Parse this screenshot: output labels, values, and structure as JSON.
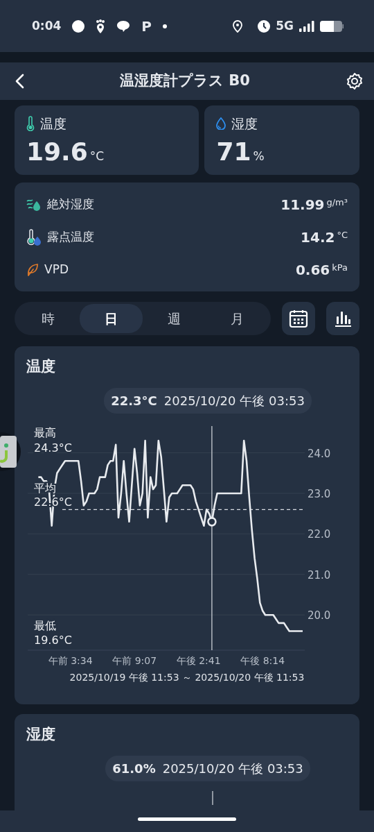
{
  "status_bar": {
    "time": "0:04",
    "notification_glyph": "P",
    "network": "5G"
  },
  "header": {
    "title": "温湿度計プラス B0"
  },
  "readings": [
    {
      "label": "温度",
      "value": "19.6",
      "unit": "°C"
    },
    {
      "label": "湿度",
      "value": "71",
      "unit": "%"
    }
  ],
  "details": [
    {
      "label": "絶対湿度",
      "value": "11.99",
      "unit": "g/m³"
    },
    {
      "label": "露点温度",
      "value": "14.2",
      "unit": "°C"
    },
    {
      "label": "VPD",
      "value": "0.66",
      "unit": "kPa"
    }
  ],
  "period_tabs": [
    {
      "label": "時",
      "selected": false
    },
    {
      "label": "日",
      "selected": true
    },
    {
      "label": "週",
      "selected": false
    },
    {
      "label": "月",
      "selected": false
    }
  ],
  "charts": [
    {
      "title": "温度",
      "tooltip": {
        "value": "22.3°C",
        "time": "2025/10/20 午後 03:53"
      },
      "stats": [
        {
          "label": "最高",
          "value": "24.3°C"
        },
        {
          "label": "平均",
          "value": "22.6°C"
        },
        {
          "label": "最低",
          "value": "19.6°C"
        }
      ],
      "range": "2025/10/19 午後 11:53 ～ 2025/10/20 午後 11:53",
      "chart_data": {
        "type": "line",
        "ylim": [
          19.13,
          24.66
        ],
        "yticks": [
          {
            "value": 20,
            "label": "20.0"
          },
          {
            "value": 21,
            "label": "21.0"
          },
          {
            "value": 22,
            "label": "22.0"
          },
          {
            "value": 23,
            "label": "23.0"
          },
          {
            "value": 24,
            "label": "24.0"
          }
        ],
        "categories": [
          null,
          null,
          null,
          null,
          null,
          null,
          null,
          null,
          null,
          null,
          null,
          null,
          null,
          null,
          null,
          null,
          "午前 3:34",
          null,
          null,
          null,
          null,
          null,
          null,
          null,
          null,
          null,
          null,
          null,
          null,
          null,
          null,
          null,
          null,
          null,
          null,
          null,
          null,
          null,
          null,
          null,
          "午前 9:07",
          null,
          null,
          null,
          null,
          null,
          null,
          null,
          null,
          null,
          null,
          null,
          null,
          null,
          null,
          null,
          null,
          null,
          null,
          null,
          null,
          null,
          null,
          null,
          "午後 2:41",
          null,
          null,
          null,
          null,
          null,
          null,
          null,
          null,
          null,
          null,
          null,
          null,
          null,
          null,
          null,
          null,
          null,
          null,
          null,
          null,
          null,
          null,
          null,
          "午後 8:14",
          null,
          null,
          null,
          null,
          null,
          null,
          null,
          null,
          null,
          null,
          null,
          null,
          null,
          null,
          null
        ],
        "series": [
          {
            "color": "#e8ebef",
            "values": [
              null,
              null,
              null,
              null,
              23.4,
              23.4,
              23.3,
              23.3,
              23.1,
              22.2,
              23.1,
              23.5,
              23.6,
              23.7,
              23.8,
              23.8,
              23.8,
              23.8,
              23.8,
              23.8,
              23.3,
              22.7,
              22.8,
              23.0,
              23.0,
              23.0,
              23.1,
              23.4,
              23.4,
              23.4,
              23.7,
              23.8,
              23.8,
              24.2,
              22.4,
              23.0,
              23.8,
              23.0,
              22.3,
              23.2,
              24.1,
              23.5,
              22.7,
              23.0,
              24.3,
              22.4,
              23.4,
              23.1,
              23.2,
              24.3,
              23.9,
              23.1,
              22.3,
              22.9,
              23.0,
              23.0,
              23.0,
              23.1,
              23.2,
              23.2,
              23.2,
              23.2,
              23.1,
              22.8,
              22.6,
              22.4,
              22.2,
              22.6,
              22.5,
              22.3,
              22.7,
              23.0,
              23.0,
              23.0,
              23.0,
              23.0,
              23.0,
              23.0,
              23.0,
              23.0,
              23.0,
              24.3,
              23.8,
              22.9,
              22.1,
              21.4,
              20.9,
              20.3,
              20.1,
              20.0,
              20.0,
              20.0,
              20.0,
              19.9,
              19.8,
              19.8,
              19.8,
              19.7,
              19.6,
              19.6,
              19.6,
              19.6,
              19.6,
              19.6
            ]
          }
        ],
        "grid": true,
        "ref_lines": [
          {
            "axis": "y",
            "value": 22.6
          }
        ]
      }
    },
    {
      "title": "湿度",
      "tooltip": {
        "value": "61.0%",
        "time": "2025/10/20 午後 03:53"
      }
    }
  ]
}
